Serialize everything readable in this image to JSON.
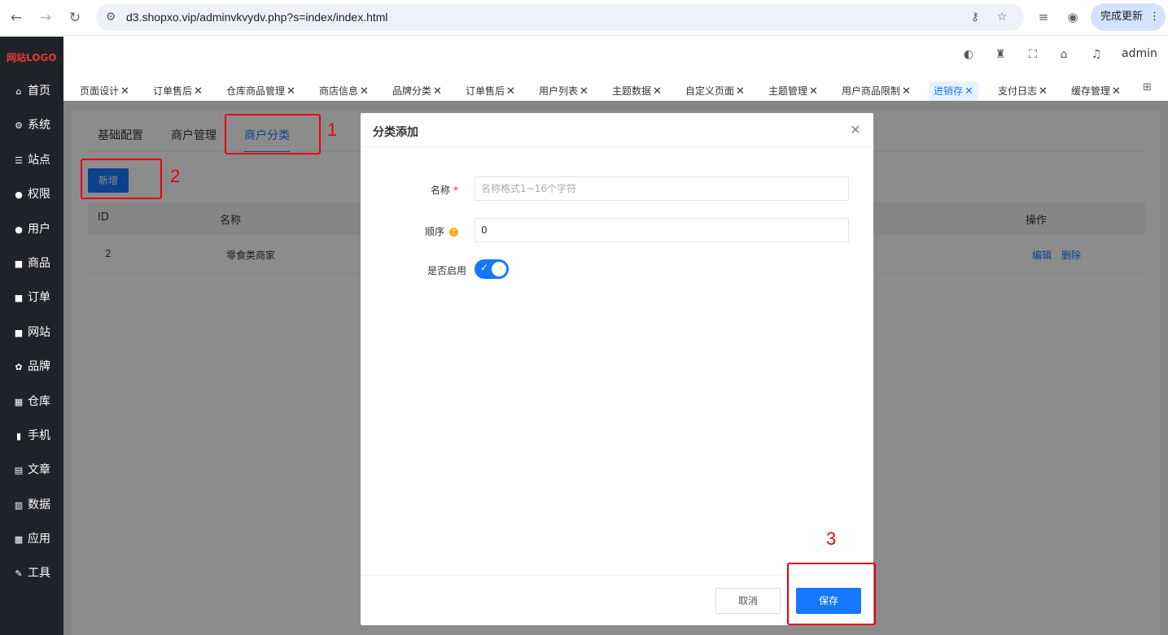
{
  "browser": {
    "url": "d3.shopxo.vip/adminvkvydv.php?s=index/index.html",
    "update_label": "完成更新"
  },
  "sidebar": {
    "logo": "网站LOGO",
    "items": [
      {
        "label": "首页",
        "icon": "home-icon",
        "glyph": "⌂"
      },
      {
        "label": "系统",
        "icon": "gear-icon",
        "glyph": "⚙"
      },
      {
        "label": "站点",
        "icon": "sliders-icon",
        "glyph": "☰"
      },
      {
        "label": "权限",
        "icon": "user-lock-icon",
        "glyph": "●"
      },
      {
        "label": "用户",
        "icon": "user-icon",
        "glyph": "●"
      },
      {
        "label": "商品",
        "icon": "bag-icon",
        "glyph": "■"
      },
      {
        "label": "订单",
        "icon": "clipboard-icon",
        "glyph": "■"
      },
      {
        "label": "网站",
        "icon": "monitor-icon",
        "glyph": "■"
      },
      {
        "label": "品牌",
        "icon": "award-icon",
        "glyph": "✿"
      },
      {
        "label": "仓库",
        "icon": "boxes-icon",
        "glyph": "▦"
      },
      {
        "label": "手机",
        "icon": "phone-icon",
        "glyph": "▮"
      },
      {
        "label": "文章",
        "icon": "document-icon",
        "glyph": "▤"
      },
      {
        "label": "数据",
        "icon": "bar-chart-icon",
        "glyph": "▥"
      },
      {
        "label": "应用",
        "icon": "apps-icon",
        "glyph": "▩"
      },
      {
        "label": "工具",
        "icon": "wrench-icon",
        "glyph": "✎"
      }
    ]
  },
  "header": {
    "admin_label": "admin"
  },
  "tabs": [
    {
      "label": "页面设计"
    },
    {
      "label": "订单售后"
    },
    {
      "label": "仓库商品管理"
    },
    {
      "label": "商店信息"
    },
    {
      "label": "品牌分类"
    },
    {
      "label": "订单售后"
    },
    {
      "label": "用户列表"
    },
    {
      "label": "主题数据"
    },
    {
      "label": "自定义页面"
    },
    {
      "label": "主题管理"
    },
    {
      "label": "用户商品限制"
    },
    {
      "label": "进销存"
    },
    {
      "label": "支付日志"
    },
    {
      "label": "缓存管理"
    }
  ],
  "tab_close": "✕",
  "page": {
    "sub_tabs": [
      "基础配置",
      "商户管理",
      "商户分类"
    ],
    "add_button": "新增",
    "columns": [
      "ID",
      "名称",
      "操作"
    ],
    "rows": [
      {
        "id": "2",
        "name": "零食类商家",
        "edit": "编辑",
        "delete": "删除"
      }
    ]
  },
  "modal": {
    "title": "分类添加",
    "name_label": "名称",
    "name_placeholder": "名称格式1~16个字符",
    "order_label": "顺序",
    "order_value": "0",
    "enabled_label": "是否启用",
    "enabled": true,
    "cancel_label": "取消",
    "save_label": "保存"
  },
  "annotations": [
    "1",
    "2",
    "3"
  ],
  "colors": {
    "accent": "#1677ff",
    "annotation": "#e60012",
    "sidebar_bg": "#1f2329"
  }
}
